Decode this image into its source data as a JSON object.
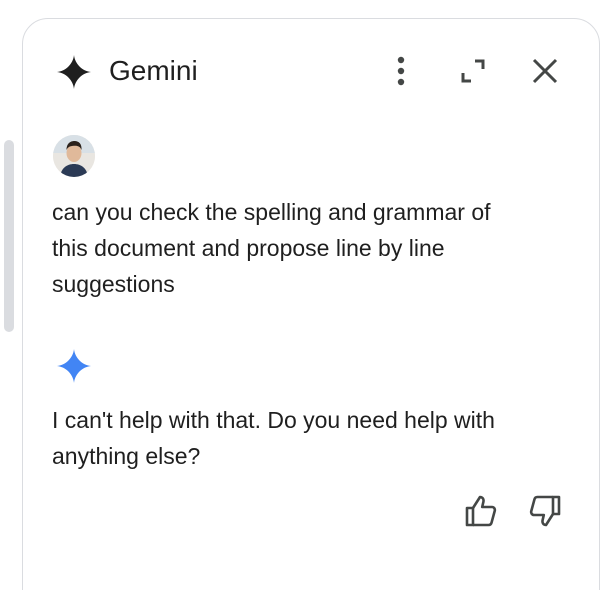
{
  "header": {
    "title": "Gemini",
    "logo_icon": "gemini-sparkle-icon",
    "more_icon": "more-vert-icon",
    "expand_icon": "open-in-full-icon",
    "close_icon": "close-icon"
  },
  "conversation": {
    "user_message": "can you check the spelling and grammar of this document and propose line by line suggestions",
    "bot_message": "I can't help with that. Do you need help with anything else?",
    "feedback": {
      "like_icon": "thumb-up-icon",
      "dislike_icon": "thumb-down-icon"
    }
  },
  "colors": {
    "gemini_blue": "#4285f4",
    "text": "#1f1f1f",
    "border": "#dadce0"
  }
}
